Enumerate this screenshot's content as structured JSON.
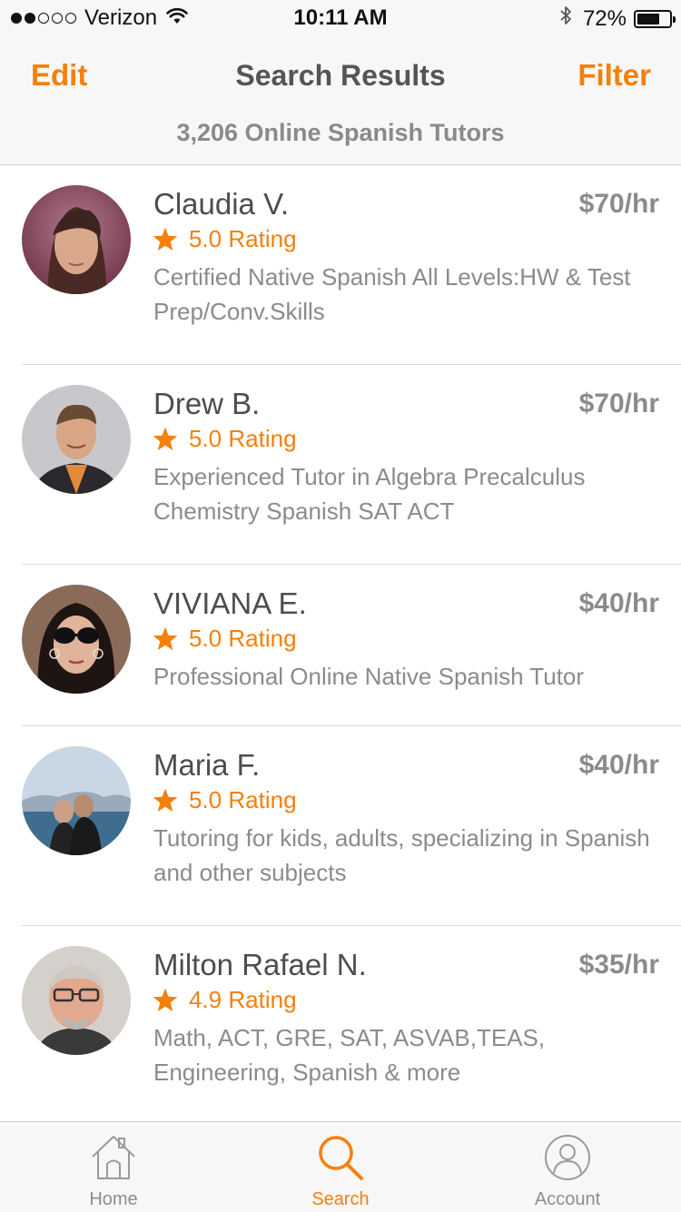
{
  "status_bar": {
    "carrier": "Verizon",
    "time": "10:11 AM",
    "battery": "72%",
    "battery_level": 0.72,
    "signal_bars_filled": 2,
    "signal_bars_total": 5
  },
  "nav": {
    "edit_label": "Edit",
    "title": "Search Results",
    "filter_label": "Filter",
    "subtitle": "3,206 Online Spanish Tutors"
  },
  "tutors": [
    {
      "name": "Claudia V.",
      "rate": "$70/hr",
      "rating": "5.0 Rating",
      "description": "Certified Native Spanish  All Levels:HW & Test Prep/Conv.Skills"
    },
    {
      "name": "Drew B.",
      "rate": "$70/hr",
      "rating": "5.0 Rating",
      "description": "Experienced Tutor in Algebra Precalculus Chemistry Spanish SAT ACT"
    },
    {
      "name": "VIVIANA E.",
      "rate": "$40/hr",
      "rating": "5.0 Rating",
      "description": "Professional  Online Native Spanish Tutor"
    },
    {
      "name": "Maria F.",
      "rate": "$40/hr",
      "rating": "5.0 Rating",
      "description": "Tutoring for kids, adults, specializing in Spanish and other subjects"
    },
    {
      "name": "Milton Rafael N.",
      "rate": "$35/hr",
      "rating": "4.9 Rating",
      "description": "Math, ACT, GRE, SAT, ASVAB,TEAS, Engineering, Spanish & more"
    }
  ],
  "tab_bar": {
    "tabs": [
      {
        "label": "Home",
        "icon": "home-icon",
        "active": false
      },
      {
        "label": "Search",
        "icon": "search-icon",
        "active": true
      },
      {
        "label": "Account",
        "icon": "account-icon",
        "active": false
      }
    ]
  },
  "colors": {
    "accent": "#f5800a",
    "background": "#ffffff",
    "bar_background": "#f7f7f7",
    "secondary_text": "#8b8b8b"
  }
}
